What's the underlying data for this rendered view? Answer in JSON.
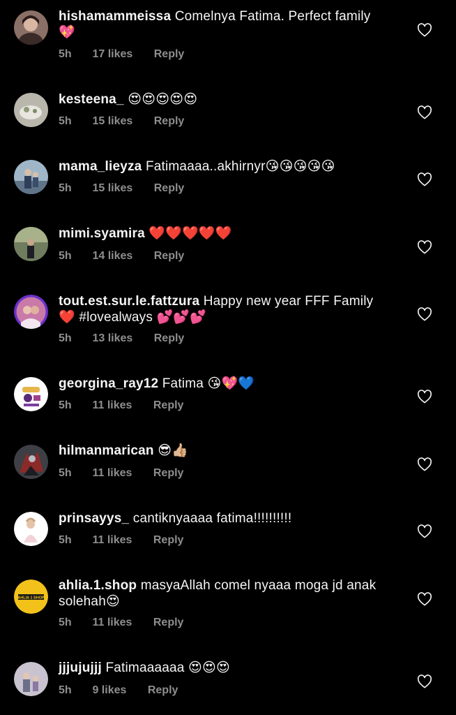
{
  "comments": [
    {
      "username": "hishamammeissa",
      "text": "Comelnya Fatima. Perfect family 💖",
      "time": "5h",
      "likes": "17 likes",
      "reply": "Reply"
    },
    {
      "username": "kesteena_",
      "text": "😍😍😍😍😍",
      "time": "5h",
      "likes": "15 likes",
      "reply": "Reply"
    },
    {
      "username": "mama_lieyza",
      "text": "Fatimaaaa..akhirnyr😘😘😘😘😘",
      "time": "5h",
      "likes": "15 likes",
      "reply": "Reply"
    },
    {
      "username": "mimi.syamira",
      "text": "❤️❤️❤️❤️❤️",
      "time": "5h",
      "likes": "14 likes",
      "reply": "Reply"
    },
    {
      "username": "tout.est.sur.le.fattzura",
      "text": "Happy new year FFF Family ❤️ #lovealways 💕💕💕",
      "time": "5h",
      "likes": "13 likes",
      "reply": "Reply"
    },
    {
      "username": "georgina_ray12",
      "text": "Fatima 😘💖💙",
      "time": "5h",
      "likes": "11 likes",
      "reply": "Reply"
    },
    {
      "username": "hilmanmarican",
      "text": "😎👍🏼",
      "time": "5h",
      "likes": "11 likes",
      "reply": "Reply"
    },
    {
      "username": "prinsayys_",
      "text": "cantiknyaaaa fatima!!!!!!!!!!",
      "time": "5h",
      "likes": "11 likes",
      "reply": "Reply"
    },
    {
      "username": "ahlia.1.shop",
      "text": "masyaAllah comel nyaaa moga jd anak solehah😍",
      "time": "5h",
      "likes": "11 likes",
      "reply": "Reply",
      "avatar_text": "AHLIA 1 SHOP"
    },
    {
      "username": "jjjujujjj",
      "text": "Fatimaaaaaa 😍😍😍",
      "time": "5h",
      "likes": "9 likes",
      "reply": "Reply"
    }
  ],
  "colors": {
    "background": "#000000",
    "text": "#f5f5f5",
    "meta": "#8e8e8e"
  },
  "icons": {
    "like": "heart-outline-icon"
  }
}
